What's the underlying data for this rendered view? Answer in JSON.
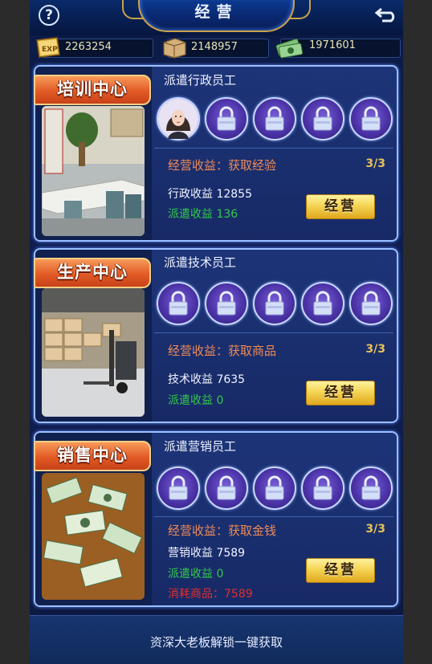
{
  "header": {
    "title": "经营",
    "help_label": "?",
    "back_label": "⮌"
  },
  "resources": [
    {
      "icon": "exp-icon",
      "icon_text": "EXP",
      "value": "2263254"
    },
    {
      "icon": "crate-icon",
      "value": "2148957"
    },
    {
      "icon": "cash-icon",
      "value": "1971601"
    }
  ],
  "centers": [
    {
      "name": "培训中心",
      "dispatch_title": "派遣行政员工",
      "slots": [
        "avatar",
        "locked",
        "locked",
        "locked",
        "locked"
      ],
      "perk": "经营收益：获取经验",
      "count": "3/3",
      "income": "行政收益 12855",
      "dispatch_income": "派遣收益 136",
      "button": "经营"
    },
    {
      "name": "生产中心",
      "dispatch_title": "派遣技术员工",
      "slots": [
        "locked",
        "locked",
        "locked",
        "locked",
        "locked"
      ],
      "perk": "经营收益：获取商品",
      "count": "3/3",
      "income": "技术收益 7635",
      "dispatch_income": "派遣收益 0",
      "button": "经营"
    },
    {
      "name": "销售中心",
      "dispatch_title": "派遣营销员工",
      "slots": [
        "locked",
        "locked",
        "locked",
        "locked",
        "locked"
      ],
      "perk": "经营收益：获取金钱",
      "count": "3/3",
      "income": "营销收益 7589",
      "dispatch_income": "派遣收益 0",
      "cost": "消耗商品：7589",
      "button": "经营"
    }
  ],
  "footer": {
    "text": "资深大老板解锁一键获取"
  },
  "colors": {
    "perk": "#ef8a56",
    "dispatch_income": "#33c94a",
    "cost": "#e22d2d",
    "count": "#e5c35c"
  }
}
